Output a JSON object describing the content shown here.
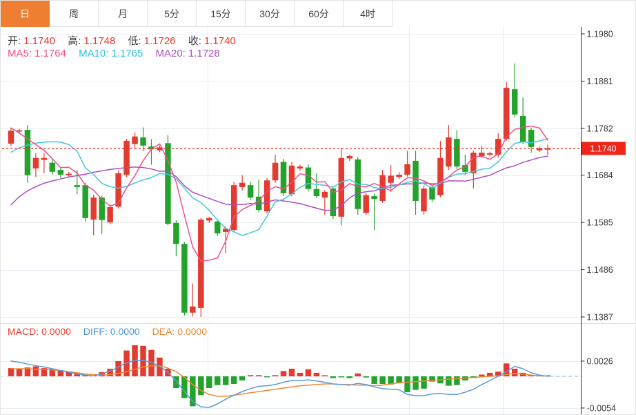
{
  "tabs": {
    "items": [
      {
        "label": "日",
        "selected": true
      },
      {
        "label": "周",
        "selected": false
      },
      {
        "label": "月",
        "selected": false
      },
      {
        "label": "5分",
        "selected": false
      },
      {
        "label": "15分",
        "selected": false
      },
      {
        "label": "30分",
        "selected": false
      },
      {
        "label": "60分",
        "selected": false
      },
      {
        "label": "4时",
        "selected": false
      }
    ]
  },
  "legend": {
    "open_label": "开:",
    "open_value": "1.1740",
    "high_label": "高:",
    "high_value": "1.1748",
    "low_label": "低:",
    "low_value": "1.1726",
    "close_label": "收:",
    "close_value": "1.1740",
    "ma5_label": "MA5:",
    "ma5_value": "1.1764",
    "ma10_label": "MA10:",
    "ma10_value": "1.1765",
    "ma20_label": "MA20:",
    "ma20_value": "1.1728"
  },
  "macd_legend": {
    "macd_label": "MACD:",
    "macd_value": "0.0000",
    "diff_label": "DIFF:",
    "diff_value": "0.0000",
    "dea_label": "DEA:",
    "dea_value": "0.0000"
  },
  "colors": {
    "up": "#e23b30",
    "down": "#24a32c",
    "ma5": "#ee4f8b",
    "ma10": "#45c5dd",
    "ma20": "#aa4fc0",
    "diff": "#5a9bd8",
    "dea": "#ee8833",
    "tab_active_bg": "#ee7e31",
    "price_tag_bg": "#ee2619",
    "dotted_line": "#ee3326",
    "grid": "#e6edf4",
    "axis_line": "#2a2a2a",
    "axis_text": "#3a3a3a",
    "zero_dash": "#c7ddf0",
    "zero_dash_bright": "#9fd0ea",
    "divider": "#e0e0e0"
  },
  "chart_data": {
    "type": "candlestick",
    "panels": [
      "price+MA",
      "MACD"
    ],
    "price_axis": {
      "max": 1.198,
      "min": 1.1387,
      "ticks": [
        "1.1980",
        "1.1881",
        "1.1782",
        "1.1684",
        "1.1585",
        "1.1486",
        "1.1387"
      ],
      "current_price": 1.174,
      "current_label": "1.1740"
    },
    "macd_axis": {
      "ticks": [
        {
          "label": "0.0026",
          "value": 0.0026
        },
        {
          "label": "-0.0054",
          "value": -0.0054
        }
      ]
    },
    "ma_periods": [
      5,
      10,
      20
    ],
    "ma_head": {
      "ma5": [
        1.1783,
        1.1772,
        1.176,
        1.1748
      ],
      "ma10": [
        1.1732,
        1.1741,
        1.1747,
        1.1751,
        1.1753,
        1.1754,
        1.1753,
        1.1748,
        1.1734
      ],
      "ma20": [
        1.1622,
        1.1639,
        1.1651,
        1.166,
        1.1667,
        1.1672,
        1.1676,
        1.168,
        1.1683,
        1.1686,
        1.169,
        1.1693,
        1.1696,
        1.1698,
        1.17,
        1.1701,
        1.17,
        1.1697,
        1.1692
      ]
    },
    "candles": [
      [
        1.175,
        1.1784,
        1.1745,
        1.1777
      ],
      [
        1.1776,
        1.1781,
        1.177,
        1.1778
      ],
      [
        1.1779,
        1.1789,
        1.1668,
        1.1684
      ],
      [
        1.1698,
        1.173,
        1.168,
        1.172
      ],
      [
        1.1716,
        1.1731,
        1.1688,
        1.172
      ],
      [
        1.171,
        1.1717,
        1.1685,
        1.1691
      ],
      [
        1.1695,
        1.1699,
        1.1678,
        1.1685
      ],
      [
        1.1684,
        1.1691,
        1.1679,
        1.1687
      ],
      [
        1.1663,
        1.1695,
        1.1644,
        1.1659
      ],
      [
        1.1663,
        1.1668,
        1.1587,
        1.1594
      ],
      [
        1.1591,
        1.1643,
        1.1558,
        1.1637
      ],
      [
        1.1637,
        1.1641,
        1.1561,
        1.159
      ],
      [
        1.1585,
        1.1623,
        1.1581,
        1.1617
      ],
      [
        1.1618,
        1.1694,
        1.1614,
        1.1688
      ],
      [
        1.1685,
        1.176,
        1.168,
        1.1756
      ],
      [
        1.1749,
        1.1773,
        1.1738,
        1.1765
      ],
      [
        1.1763,
        1.1784,
        1.1734,
        1.1746
      ],
      [
        1.1744,
        1.1759,
        1.1706,
        1.1738
      ],
      [
        1.1736,
        1.1746,
        1.1732,
        1.1742
      ],
      [
        1.1751,
        1.1768,
        1.1579,
        1.1582
      ],
      [
        1.1584,
        1.159,
        1.1514,
        1.154
      ],
      [
        1.154,
        1.1544,
        1.139,
        1.1396
      ],
      [
        1.1396,
        1.1457,
        1.1388,
        1.1409
      ],
      [
        1.1406,
        1.1595,
        1.1387,
        1.1591
      ],
      [
        1.1589,
        1.1597,
        1.1584,
        1.1594
      ],
      [
        1.1587,
        1.1591,
        1.1557,
        1.1562
      ],
      [
        1.1565,
        1.1576,
        1.1521,
        1.1572
      ],
      [
        1.1569,
        1.167,
        1.1564,
        1.1663
      ],
      [
        1.1659,
        1.1684,
        1.1652,
        1.1668
      ],
      [
        1.1663,
        1.167,
        1.1632,
        1.1637
      ],
      [
        1.1639,
        1.1675,
        1.1606,
        1.1611
      ],
      [
        1.1608,
        1.1678,
        1.1604,
        1.1673
      ],
      [
        1.1673,
        1.1727,
        1.1668,
        1.171
      ],
      [
        1.1712,
        1.1718,
        1.164,
        1.1646
      ],
      [
        1.1644,
        1.1712,
        1.164,
        1.1704
      ],
      [
        1.1698,
        1.1706,
        1.1693,
        1.1702
      ],
      [
        1.17,
        1.1706,
        1.165,
        1.1655
      ],
      [
        1.1655,
        1.1688,
        1.1636,
        1.164
      ],
      [
        1.1637,
        1.1653,
        1.1601,
        1.1649
      ],
      [
        1.1656,
        1.1661,
        1.1592,
        1.1598
      ],
      [
        1.1597,
        1.1741,
        1.1579,
        1.172
      ],
      [
        1.1719,
        1.1727,
        1.1714,
        1.1724
      ],
      [
        1.1717,
        1.1722,
        1.1601,
        1.1613
      ],
      [
        1.1605,
        1.1646,
        1.16,
        1.1642
      ],
      [
        1.164,
        1.1645,
        1.1569,
        1.1634
      ],
      [
        1.163,
        1.1695,
        1.1626,
        1.1684
      ],
      [
        1.1668,
        1.1705,
        1.1649,
        1.1683
      ],
      [
        1.168,
        1.169,
        1.1676,
        1.1685
      ],
      [
        1.1685,
        1.1735,
        1.1681,
        1.1707
      ],
      [
        1.1714,
        1.1735,
        1.1601,
        1.163
      ],
      [
        1.1608,
        1.1662,
        1.1601,
        1.1656
      ],
      [
        1.1659,
        1.1663,
        1.1628,
        1.1633
      ],
      [
        1.1642,
        1.1756,
        1.1638,
        1.172
      ],
      [
        1.1702,
        1.1789,
        1.1695,
        1.1763
      ],
      [
        1.176,
        1.1778,
        1.1697,
        1.1702
      ],
      [
        1.1705,
        1.1727,
        1.1684,
        1.1691
      ],
      [
        1.1688,
        1.1735,
        1.1656,
        1.1731
      ],
      [
        1.1724,
        1.1746,
        1.172,
        1.1731
      ],
      [
        1.1727,
        1.1733,
        1.1723,
        1.173
      ],
      [
        1.1727,
        1.1772,
        1.1721,
        1.176
      ],
      [
        1.176,
        1.1879,
        1.1756,
        1.1867
      ],
      [
        1.1864,
        1.1918,
        1.1806,
        1.1811
      ],
      [
        1.1808,
        1.1847,
        1.1749,
        1.1753
      ],
      [
        1.1779,
        1.1783,
        1.1731,
        1.1743
      ],
      [
        1.1736,
        1.1744,
        1.1732,
        1.174
      ],
      [
        1.174,
        1.1748,
        1.1726,
        1.174
      ]
    ],
    "macd_hist": [
      0.0014,
      0.0013,
      0.0015,
      0.0017,
      0.0014,
      0.0013,
      0.001,
      0.0008,
      0.0006,
      0.0002,
      0.0001,
      0.0007,
      0.0013,
      0.0026,
      0.0044,
      0.0053,
      0.0052,
      0.0045,
      0.0032,
      0.0013,
      -0.002,
      -0.0037,
      -0.0051,
      -0.0032,
      -0.002,
      -0.0015,
      -0.0015,
      -0.0013,
      -0.0007,
      0.0002,
      0.0002,
      -0.0001,
      0.0002,
      0.0009,
      0.0013,
      0.0006,
      0.0012,
      0.0006,
      0.0001,
      -0.0003,
      -0.0001,
      -0.0003,
      0.0005,
      -0.0002,
      -0.0013,
      -0.0013,
      -0.0014,
      -0.0012,
      -0.0027,
      -0.0023,
      -0.0021,
      -0.0009,
      -0.0012,
      -0.0016,
      -0.0015,
      -0.0007,
      -0.0003,
      0.0003,
      0.0006,
      0.0008,
      0.0022,
      0.0013,
      0.0006,
      0.0002,
      0.0001,
      0.0
    ],
    "diff_line": [
      0.0026,
      0.0024,
      0.0021,
      0.0018,
      0.0016,
      0.0013,
      0.001,
      0.0007,
      0.0004,
      0.0002,
      0.0001,
      0.0004,
      0.0009,
      0.0016,
      0.0023,
      0.0027,
      0.0027,
      0.0024,
      0.0017,
      0.0007,
      -0.0008,
      -0.0026,
      -0.0043,
      -0.0052,
      -0.0053,
      -0.0047,
      -0.0039,
      -0.0032,
      -0.0026,
      -0.0021,
      -0.0017,
      -0.0016,
      -0.0014,
      -0.001,
      -0.0007,
      -0.0007,
      -0.0006,
      -0.0008,
      -0.001,
      -0.0013,
      -0.0014,
      -0.0015,
      -0.0012,
      -0.0014,
      -0.0018,
      -0.0021,
      -0.0022,
      -0.0023,
      -0.0031,
      -0.0033,
      -0.0033,
      -0.003,
      -0.0029,
      -0.0031,
      -0.0031,
      -0.0027,
      -0.0022,
      -0.0014,
      -0.0007,
      0.0,
      0.0008,
      0.0017,
      0.0013,
      0.0006,
      0.0002,
      0.0
    ],
    "dea_line": [
      0.0013,
      0.0013,
      0.0013,
      0.0012,
      0.0012,
      0.0011,
      0.001,
      0.0008,
      0.0006,
      0.0004,
      0.0003,
      0.0002,
      0.0003,
      0.0005,
      0.0008,
      0.0012,
      0.0016,
      0.0018,
      0.0018,
      0.0014,
      0.0008,
      -0.0002,
      -0.0014,
      -0.0024,
      -0.0031,
      -0.0034,
      -0.0034,
      -0.0032,
      -0.003,
      -0.0028,
      -0.0026,
      -0.0024,
      -0.0022,
      -0.002,
      -0.0018,
      -0.0016,
      -0.0015,
      -0.0014,
      -0.0013,
      -0.0013,
      -0.0014,
      -0.0014,
      -0.0015,
      -0.0015,
      -0.0016,
      -0.0015,
      -0.0013,
      -0.0011,
      -0.001,
      -0.0009,
      -0.0008,
      -0.0007,
      -0.0006,
      -0.0005,
      -0.0004,
      -0.0003,
      -0.0002,
      -0.0001,
      0.0,
      0.0001,
      0.0003,
      0.0005,
      0.0004,
      0.0002,
      0.0001,
      0.0
    ]
  }
}
